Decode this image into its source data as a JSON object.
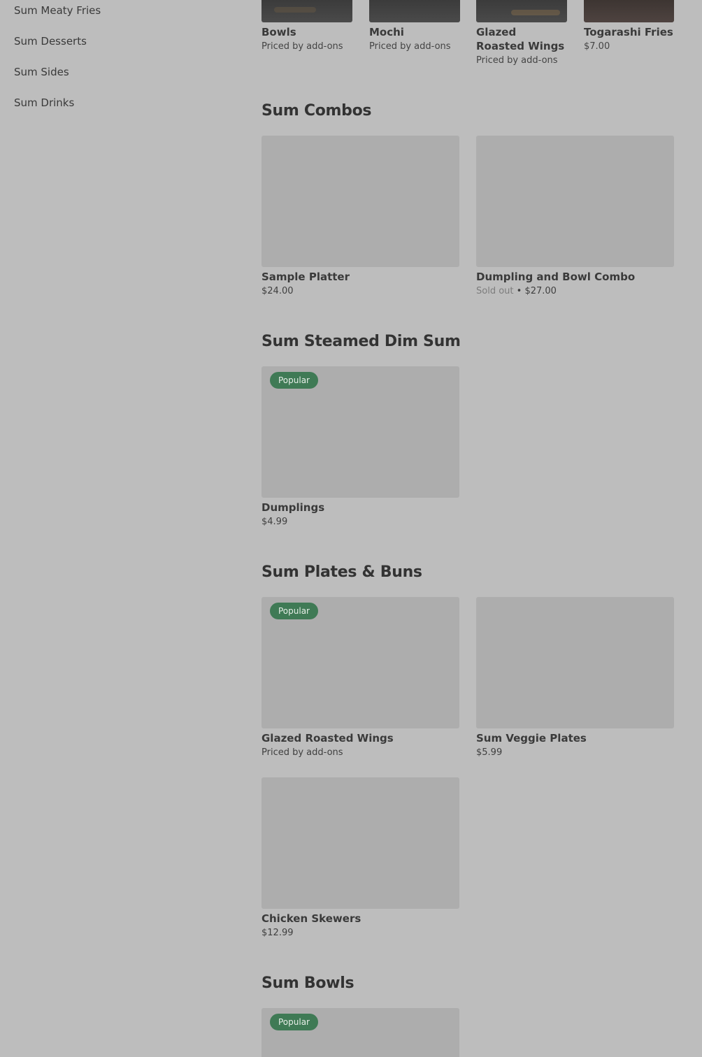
{
  "sidebar": {
    "items": [
      {
        "label": "Sum Meaty Fries"
      },
      {
        "label": "Sum Desserts"
      },
      {
        "label": "Sum Sides"
      },
      {
        "label": "Sum Drinks"
      }
    ]
  },
  "featured": [
    {
      "name": "Bowls",
      "price": "Priced by add-ons"
    },
    {
      "name": "Mochi",
      "price": "Priced by add-ons"
    },
    {
      "name": "Glazed Roasted Wings",
      "price": "Priced by add-ons"
    },
    {
      "name": "Togarashi Fries",
      "price": "$7.00"
    }
  ],
  "sections": [
    {
      "title": "Sum Combos",
      "items": [
        {
          "name": "Sample Platter",
          "price": "$24.00"
        },
        {
          "name": "Dumpling and Bowl Combo",
          "status": "Sold out",
          "separator": " • ",
          "price": "$27.00"
        }
      ]
    },
    {
      "title": "Sum Steamed Dim Sum",
      "items": [
        {
          "badge": "Popular",
          "name": "Dumplings",
          "price": "$4.99"
        }
      ]
    },
    {
      "title": "Sum Plates & Buns",
      "items": [
        {
          "badge": "Popular",
          "name": "Glazed Roasted Wings",
          "price": "Priced by add-ons"
        },
        {
          "name": "Sum Veggie Plates",
          "price": "$5.99"
        },
        {
          "name": "Chicken Skewers",
          "price": "$12.99"
        }
      ]
    },
    {
      "title": "Sum Bowls",
      "items": [
        {
          "badge": "Popular"
        }
      ]
    }
  ],
  "colors": {
    "background": "#bdbdbd",
    "image_placeholder": "#adadad",
    "badge": "#3f7a55"
  }
}
